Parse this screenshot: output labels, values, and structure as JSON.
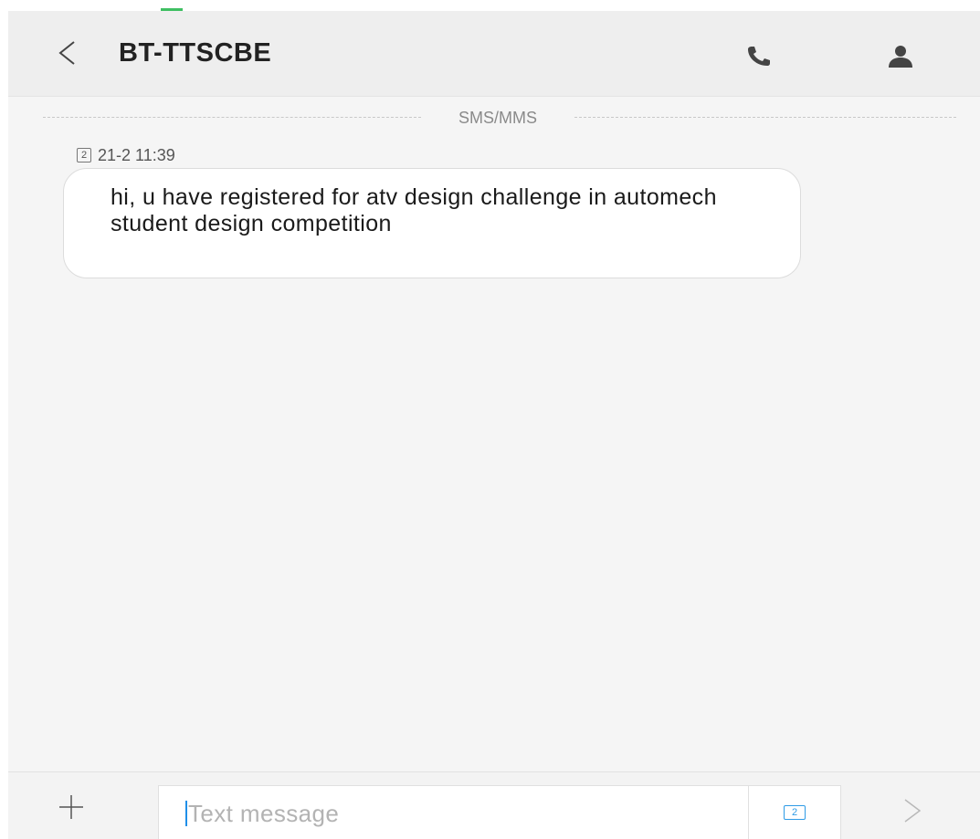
{
  "header": {
    "title": "BT-TTSCBE",
    "back_icon": "chevron-left-icon",
    "call_icon": "phone-icon",
    "contact_icon": "person-icon"
  },
  "conversation": {
    "channel_label": "SMS/MMS",
    "messages": [
      {
        "sim": "2",
        "time": "21-2 11:39",
        "text": "hi, u have registered for atv design challenge in automech student design competition"
      }
    ]
  },
  "composer": {
    "add_icon": "plus-icon",
    "placeholder": "Text message",
    "value": "",
    "sim_selector": "2",
    "send_icon": "chevron-right-icon"
  },
  "colors": {
    "background": "#f5f5f5",
    "header": "#eeeeee",
    "bubble": "#ffffff",
    "accent": "#2e9be6",
    "caret": "#1f8fe8"
  }
}
